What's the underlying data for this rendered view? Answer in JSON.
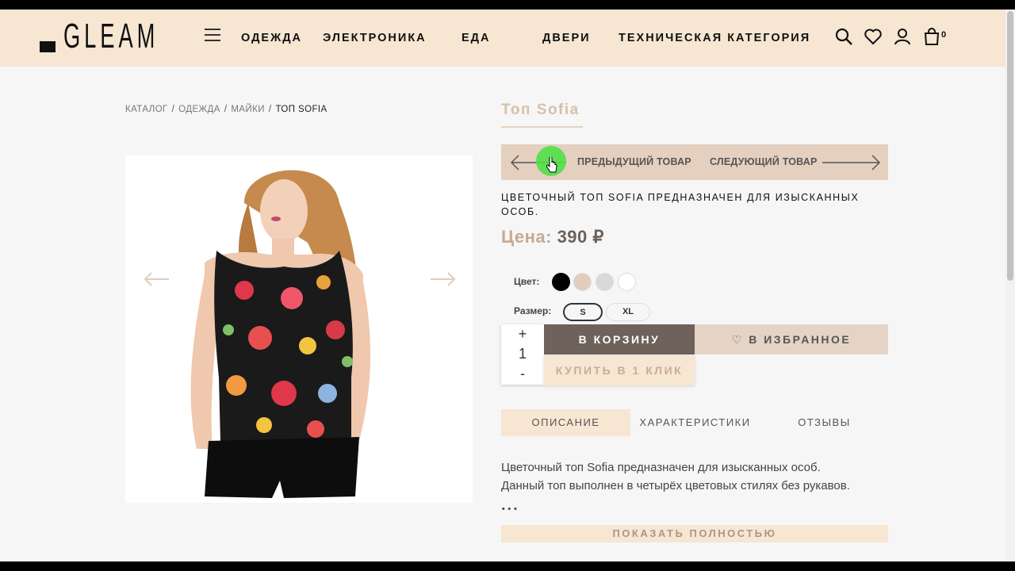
{
  "header": {
    "logo_text": "GLEAM",
    "nav": [
      "ОДЕЖДА",
      "ЭЛЕКТРОНИКА",
      "ЕДА",
      "ДВЕРИ",
      "ТЕХНИЧЕСКАЯ КАТЕГОРИЯ"
    ],
    "cart_count": "0",
    "icons": [
      "menu-icon",
      "search-icon",
      "heart-icon",
      "user-icon",
      "cart-icon"
    ]
  },
  "breadcrumb": {
    "items": [
      "КАТАЛОГ",
      "ОДЕЖДА",
      "МАЙКИ"
    ],
    "current": "ТОП SOFIA",
    "separator": "/"
  },
  "product": {
    "title": "Топ Sofia",
    "prev_label": "ПРЕДЫДУЩИЙ ТОВАР",
    "next_label": "СЛЕДУЮЩИЙ ТОВАР",
    "short_description": "ЦВЕТОЧНЫЙ ТОП SOFIA ПРЕДНАЗНАЧЕН ДЛЯ ИЗЫСКАННЫХ ОСОБ.",
    "price_label": "Цена:",
    "price_value": "390 ₽",
    "color_label": "Цвет:",
    "colors": [
      "#000000",
      "#e2cdbb",
      "#d9d9d9",
      "#ffffff"
    ],
    "size_label": "Размер:",
    "sizes": [
      "S",
      "XL"
    ],
    "selected_size": "S",
    "quantity": "1",
    "qty_plus": "+",
    "qty_minus": "-",
    "add_to_cart": "В КОРЗИНУ",
    "add_to_favorites": "В ИЗБРАННОЕ",
    "buy_one_click": "КУПИТЬ В 1 КЛИК"
  },
  "tabs": [
    "ОПИСАНИЕ",
    "ХАРАКТЕРИСТИКИ",
    "ОТЗЫВЫ"
  ],
  "active_tab": "ОПИСАНИЕ",
  "description": {
    "line1": "Цветочный топ Sofia предназначен для изысканных особ.",
    "line2": "Данный топ выполнен в четырёх цветовых стилях без рукавов.",
    "ellipsis": "...",
    "show_more": "ПОКАЗАТЬ ПОЛНОСТЬЮ"
  },
  "colors": {
    "header_bg": "#f6e6d2",
    "accent": "#c5aa94",
    "cart_button": "#6e625b"
  }
}
